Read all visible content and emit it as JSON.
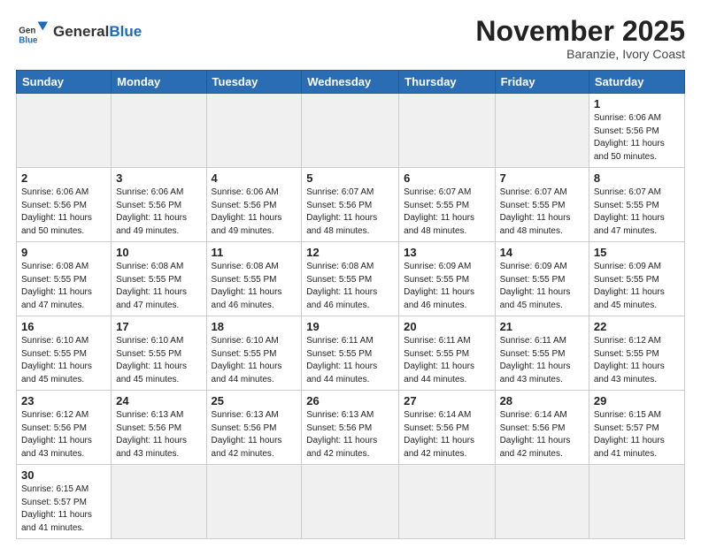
{
  "header": {
    "logo_general": "General",
    "logo_blue": "Blue",
    "month_title": "November 2025",
    "location": "Baranzie, Ivory Coast"
  },
  "days_of_week": [
    "Sunday",
    "Monday",
    "Tuesday",
    "Wednesday",
    "Thursday",
    "Friday",
    "Saturday"
  ],
  "weeks": [
    [
      {
        "num": "",
        "info": ""
      },
      {
        "num": "",
        "info": ""
      },
      {
        "num": "",
        "info": ""
      },
      {
        "num": "",
        "info": ""
      },
      {
        "num": "",
        "info": ""
      },
      {
        "num": "",
        "info": ""
      },
      {
        "num": "1",
        "info": "Sunrise: 6:06 AM\nSunset: 5:56 PM\nDaylight: 11 hours\nand 50 minutes."
      }
    ],
    [
      {
        "num": "2",
        "info": "Sunrise: 6:06 AM\nSunset: 5:56 PM\nDaylight: 11 hours\nand 50 minutes."
      },
      {
        "num": "3",
        "info": "Sunrise: 6:06 AM\nSunset: 5:56 PM\nDaylight: 11 hours\nand 49 minutes."
      },
      {
        "num": "4",
        "info": "Sunrise: 6:06 AM\nSunset: 5:56 PM\nDaylight: 11 hours\nand 49 minutes."
      },
      {
        "num": "5",
        "info": "Sunrise: 6:07 AM\nSunset: 5:56 PM\nDaylight: 11 hours\nand 48 minutes."
      },
      {
        "num": "6",
        "info": "Sunrise: 6:07 AM\nSunset: 5:55 PM\nDaylight: 11 hours\nand 48 minutes."
      },
      {
        "num": "7",
        "info": "Sunrise: 6:07 AM\nSunset: 5:55 PM\nDaylight: 11 hours\nand 48 minutes."
      },
      {
        "num": "8",
        "info": "Sunrise: 6:07 AM\nSunset: 5:55 PM\nDaylight: 11 hours\nand 47 minutes."
      }
    ],
    [
      {
        "num": "9",
        "info": "Sunrise: 6:08 AM\nSunset: 5:55 PM\nDaylight: 11 hours\nand 47 minutes."
      },
      {
        "num": "10",
        "info": "Sunrise: 6:08 AM\nSunset: 5:55 PM\nDaylight: 11 hours\nand 47 minutes."
      },
      {
        "num": "11",
        "info": "Sunrise: 6:08 AM\nSunset: 5:55 PM\nDaylight: 11 hours\nand 46 minutes."
      },
      {
        "num": "12",
        "info": "Sunrise: 6:08 AM\nSunset: 5:55 PM\nDaylight: 11 hours\nand 46 minutes."
      },
      {
        "num": "13",
        "info": "Sunrise: 6:09 AM\nSunset: 5:55 PM\nDaylight: 11 hours\nand 46 minutes."
      },
      {
        "num": "14",
        "info": "Sunrise: 6:09 AM\nSunset: 5:55 PM\nDaylight: 11 hours\nand 45 minutes."
      },
      {
        "num": "15",
        "info": "Sunrise: 6:09 AM\nSunset: 5:55 PM\nDaylight: 11 hours\nand 45 minutes."
      }
    ],
    [
      {
        "num": "16",
        "info": "Sunrise: 6:10 AM\nSunset: 5:55 PM\nDaylight: 11 hours\nand 45 minutes."
      },
      {
        "num": "17",
        "info": "Sunrise: 6:10 AM\nSunset: 5:55 PM\nDaylight: 11 hours\nand 45 minutes."
      },
      {
        "num": "18",
        "info": "Sunrise: 6:10 AM\nSunset: 5:55 PM\nDaylight: 11 hours\nand 44 minutes."
      },
      {
        "num": "19",
        "info": "Sunrise: 6:11 AM\nSunset: 5:55 PM\nDaylight: 11 hours\nand 44 minutes."
      },
      {
        "num": "20",
        "info": "Sunrise: 6:11 AM\nSunset: 5:55 PM\nDaylight: 11 hours\nand 44 minutes."
      },
      {
        "num": "21",
        "info": "Sunrise: 6:11 AM\nSunset: 5:55 PM\nDaylight: 11 hours\nand 43 minutes."
      },
      {
        "num": "22",
        "info": "Sunrise: 6:12 AM\nSunset: 5:55 PM\nDaylight: 11 hours\nand 43 minutes."
      }
    ],
    [
      {
        "num": "23",
        "info": "Sunrise: 6:12 AM\nSunset: 5:56 PM\nDaylight: 11 hours\nand 43 minutes."
      },
      {
        "num": "24",
        "info": "Sunrise: 6:13 AM\nSunset: 5:56 PM\nDaylight: 11 hours\nand 43 minutes."
      },
      {
        "num": "25",
        "info": "Sunrise: 6:13 AM\nSunset: 5:56 PM\nDaylight: 11 hours\nand 42 minutes."
      },
      {
        "num": "26",
        "info": "Sunrise: 6:13 AM\nSunset: 5:56 PM\nDaylight: 11 hours\nand 42 minutes."
      },
      {
        "num": "27",
        "info": "Sunrise: 6:14 AM\nSunset: 5:56 PM\nDaylight: 11 hours\nand 42 minutes."
      },
      {
        "num": "28",
        "info": "Sunrise: 6:14 AM\nSunset: 5:56 PM\nDaylight: 11 hours\nand 42 minutes."
      },
      {
        "num": "29",
        "info": "Sunrise: 6:15 AM\nSunset: 5:57 PM\nDaylight: 11 hours\nand 41 minutes."
      }
    ],
    [
      {
        "num": "30",
        "info": "Sunrise: 6:15 AM\nSunset: 5:57 PM\nDaylight: 11 hours\nand 41 minutes."
      },
      {
        "num": "",
        "info": ""
      },
      {
        "num": "",
        "info": ""
      },
      {
        "num": "",
        "info": ""
      },
      {
        "num": "",
        "info": ""
      },
      {
        "num": "",
        "info": ""
      },
      {
        "num": "",
        "info": ""
      }
    ]
  ]
}
